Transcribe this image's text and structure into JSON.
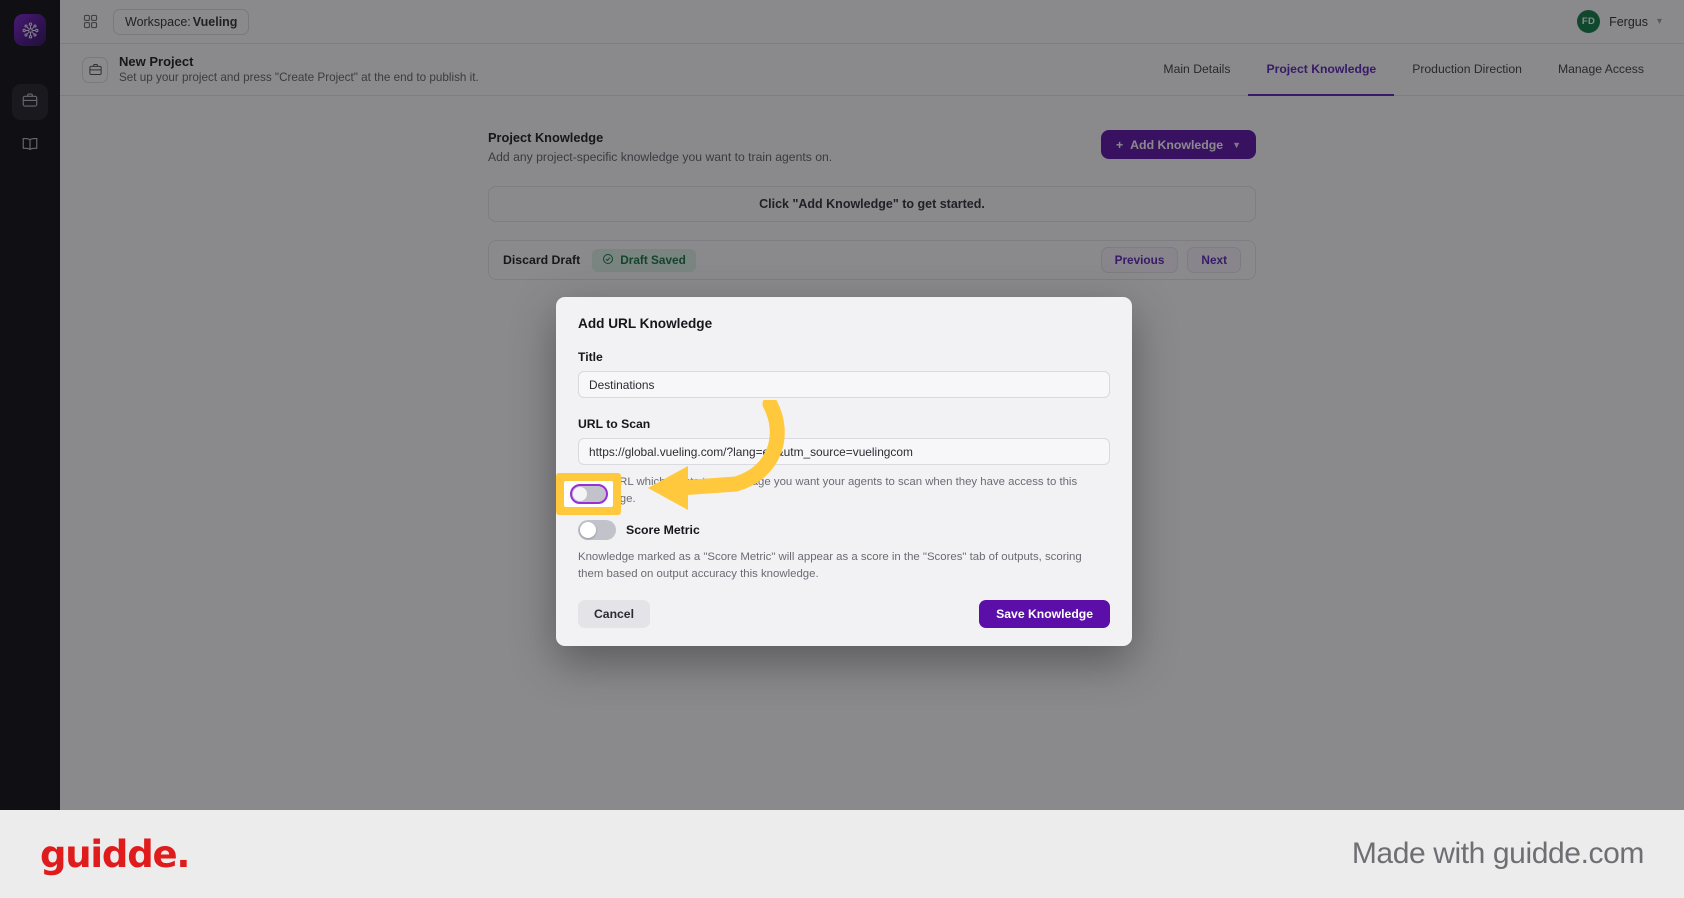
{
  "rail": {
    "logo_icon": "network-nodes-logo-icon",
    "items": [
      {
        "icon": "briefcase-icon",
        "name": "projects",
        "active": true
      },
      {
        "icon": "book-icon",
        "name": "library",
        "active": false
      }
    ]
  },
  "topbar": {
    "grid_icon": "grid-apps-icon",
    "workspace_prefix": "Workspace:",
    "workspace_name": "Vueling",
    "avatar_initials": "FD",
    "user_name": "Fergus",
    "caret_icon": "chevron-down-icon"
  },
  "subheader": {
    "project_icon": "briefcase-icon",
    "title": "New Project",
    "subtitle": "Set up your project and press \"Create Project\" at the end to publish it.",
    "tabs": [
      {
        "label": "Main Details",
        "active": false
      },
      {
        "label": "Project Knowledge",
        "active": true
      },
      {
        "label": "Production Direction",
        "active": false
      },
      {
        "label": "Manage Access",
        "active": false
      }
    ]
  },
  "panel": {
    "title": "Project Knowledge",
    "description": "Add any project-specific knowledge you want to train agents on.",
    "add_button": {
      "plus": "+",
      "label": "Add Knowledge",
      "chevron": "⌄"
    },
    "empty_state": "Click \"Add Knowledge\" to get started."
  },
  "draft_bar": {
    "discard_label": "Discard Draft",
    "saved_icon": "check-circle-icon",
    "saved_label": "Draft Saved",
    "previous_label": "Previous",
    "next_label": "Next"
  },
  "modal": {
    "title": "Add URL Knowledge",
    "title_field": {
      "label": "Title",
      "value": "Destinations",
      "placeholder": "Title"
    },
    "url_field": {
      "label": "URL to Scan",
      "value": "https://global.vueling.com/?lang=en&utm_source=vuelingcom",
      "placeholder": "https://"
    },
    "url_helper": "Add a URL which points to a webpage you want your agents to scan when they have access to this knowledge.",
    "score_metric": {
      "label": "Score Metric",
      "enabled": false,
      "helper": "Knowledge marked as a \"Score Metric\" will appear as a score in the \"Scores\" tab of outputs, scoring them based on output accuracy this knowledge."
    },
    "cancel_label": "Cancel",
    "save_label": "Save Knowledge"
  },
  "annotation": {
    "highlight_target": "score-metric-toggle",
    "arrow_color": "#ffc83d",
    "highlight_color": "#ffc83d"
  },
  "footer": {
    "logo_text": "guidde.",
    "made_with": "Made with guidde.com"
  },
  "colors": {
    "brand_purple": "#5b0fa8",
    "tab_active": "#5b21b6",
    "avatar_green": "#0a7b43",
    "saved_green": "#13713f",
    "annotation_yellow": "#ffc83d",
    "guidde_red": "#e01b1b"
  }
}
